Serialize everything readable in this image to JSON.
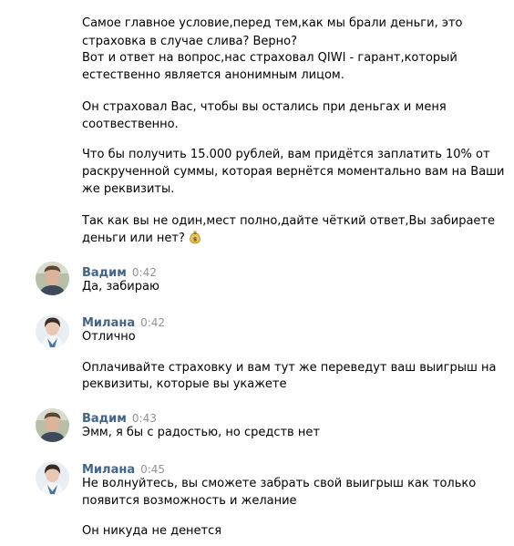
{
  "intro_lines": [
    "Самое главное условие,перед тем,как мы брали деньги, это",
    "страховка в случае слива? Верно?",
    "Вот и ответ на вопрос,нас страховал QIWI - гарант,который",
    "естественно является анонимным лицом.",
    "Он страховал Вас, чтобы вы остались при деньгах и меня",
    "соотвественно.",
    "Что бы получить 15.000 рублей, вам придётся заплатить 10% от",
    "раскрученной суммы, которая вернётся моментально вам на Ваши",
    "же реквизиты.",
    "Так как вы не один,мест полно,дайте чёткий ответ,Вы забираете",
    "деньги или нет?"
  ],
  "messages": [
    {
      "author": "Вадим",
      "time": "0:42",
      "lines": [
        "Да, забираю"
      ]
    },
    {
      "author": "Милана",
      "time": "0:42",
      "lines": [
        "Отлично",
        "Оплачивайте страховку и вам тут же переведут ваш выигрыш на",
        "реквизиты, которые вы укажете"
      ]
    },
    {
      "author": "Вадим",
      "time": "0:43",
      "lines": [
        "Эмм, я бы с радостью, но средств нет"
      ]
    },
    {
      "author": "Милана",
      "time": "0:45",
      "lines": [
        "Не волнуйтесь, вы сможете забрать свой выигрыш как только",
        "появится возможность и желание",
        "Он никуда не денется"
      ]
    }
  ],
  "icons": {
    "money_bag": "money-bag-emoji"
  },
  "colors": {
    "author": "#42648b",
    "time": "#939393",
    "text": "#000000"
  }
}
